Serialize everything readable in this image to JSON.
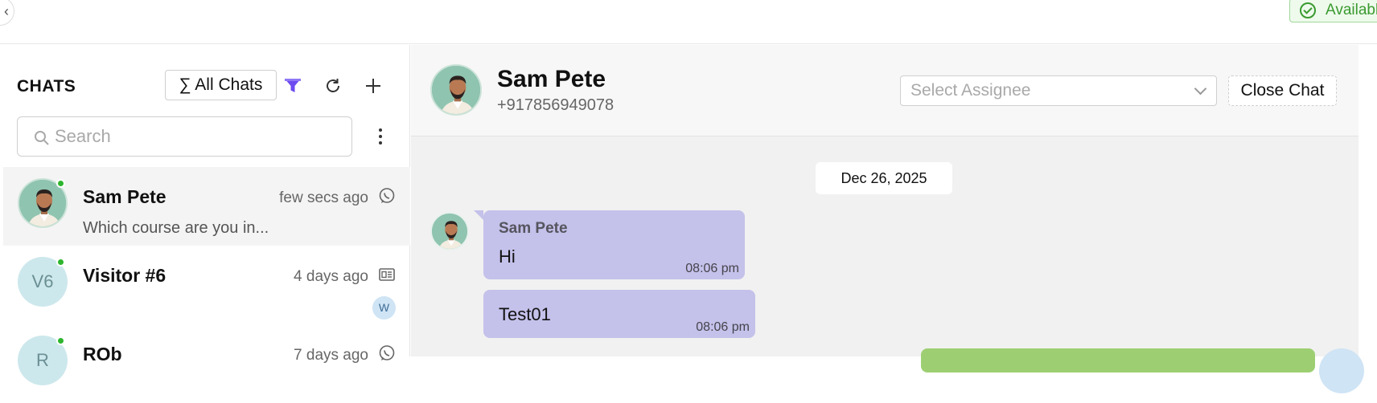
{
  "topbar": {
    "back_label": "‹",
    "availability": "Available",
    "availability_color": "#3a9a2f"
  },
  "left": {
    "title": "CHATS",
    "filter_label": "∑ All Chats",
    "accent": "#6d4af0",
    "search_placeholder": "Search",
    "chats": [
      {
        "name": "Sam Pete",
        "time": "few secs ago",
        "preview": "Which course are you in...",
        "channel": "whatsapp-icon",
        "online": true,
        "avatar": "avatar-image"
      },
      {
        "name": "Visitor #6",
        "time": "4 days ago",
        "preview": "",
        "channel": "webchat-icon",
        "online": true,
        "avatar_text": "V6",
        "badge": "W"
      },
      {
        "name": "ROb",
        "time": "7 days ago",
        "preview": "",
        "channel": "whatsapp-icon",
        "online": true,
        "avatar_text": "R"
      }
    ]
  },
  "conversation": {
    "name": "Sam Pete",
    "phone": "+917856949078",
    "assignee_placeholder": "Select Assignee",
    "close_label": "Close Chat",
    "date": "Dec 26, 2025",
    "messages": [
      {
        "sender": "Sam Pete",
        "text": "Hi",
        "time": "08:06 pm",
        "direction": "incoming"
      },
      {
        "text": "Test01",
        "time": "08:06 pm",
        "direction": "incoming"
      }
    ],
    "incoming_color": "#c4c1ea",
    "outgoing_color": "#9dcf72"
  }
}
